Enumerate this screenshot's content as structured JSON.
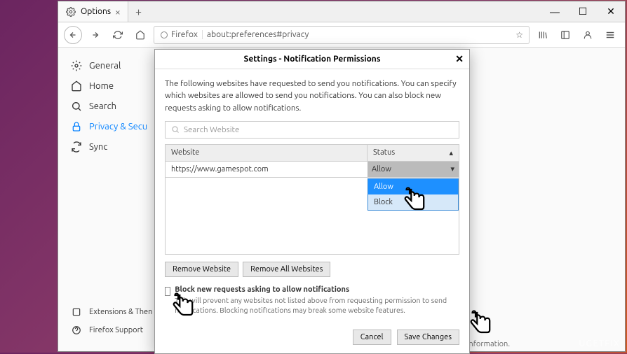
{
  "window": {
    "tab_title": "Options",
    "url_label": "Firefox",
    "url": "about:preferences#privacy"
  },
  "sidebar": {
    "items": [
      {
        "label": "General"
      },
      {
        "label": "Home"
      },
      {
        "label": "Search"
      },
      {
        "label": "Privacy & Secu"
      },
      {
        "label": "Sync"
      }
    ],
    "bottom": [
      {
        "label": "Extensions & Then"
      },
      {
        "label": "Firefox Support"
      }
    ]
  },
  "footer_text": "Firefox for everyone. We always ask permission before receiving personal information.",
  "modal": {
    "title": "Settings - Notification Permissions",
    "description": "The following websites have requested to send you notifications. You can specify which websites are allowed to send you notifications. You can also block new requests asking to allow notifications.",
    "search_placeholder": "Search Website",
    "col_website": "Website",
    "col_status": "Status",
    "rows": [
      {
        "url": "https://www.gamespot.com",
        "status": "Allow"
      }
    ],
    "dropdown": {
      "allow": "Allow",
      "block": "Block"
    },
    "remove_website": "Remove Website",
    "remove_all": "Remove All Websites",
    "block_new_label": "Block new requests asking to allow notifications",
    "block_new_desc": "This will prevent any websites not listed above from requesting permission to send notifications. Blocking notifications may break some website features.",
    "cancel": "Cancel",
    "save": "Save Changes"
  },
  "watermark": "UGETFIX"
}
